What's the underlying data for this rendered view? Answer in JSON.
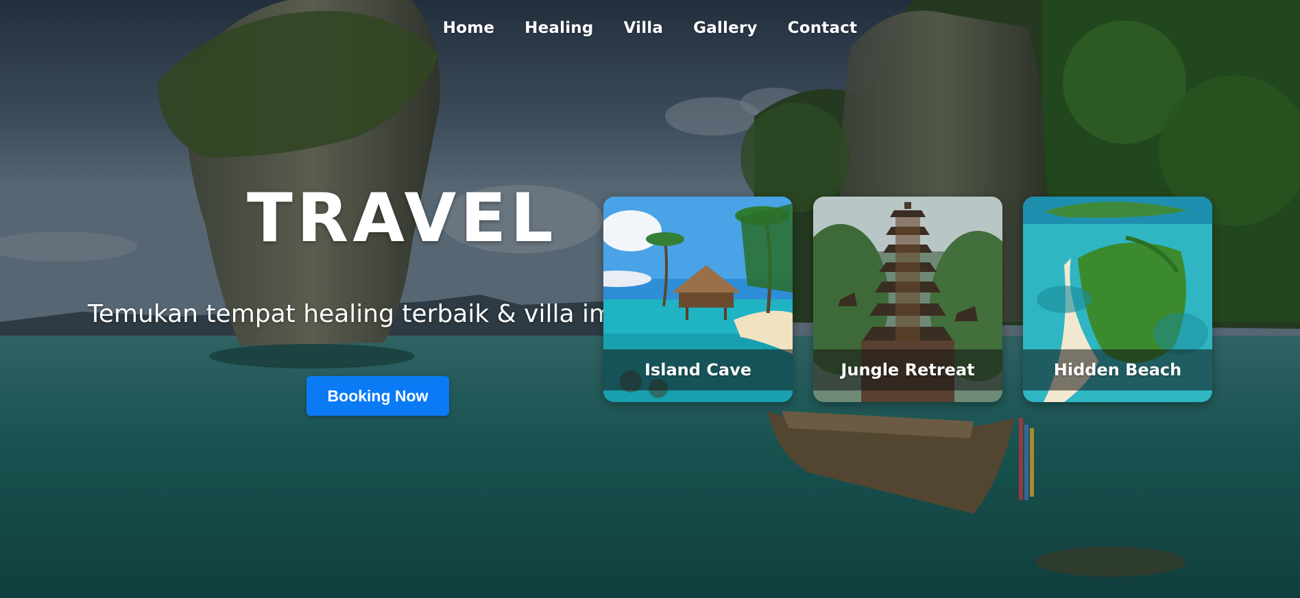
{
  "nav": {
    "items": [
      {
        "label": "Home"
      },
      {
        "label": "Healing"
      },
      {
        "label": "Villa"
      },
      {
        "label": "Gallery"
      },
      {
        "label": "Contact"
      }
    ]
  },
  "hero": {
    "title": "TRAVEL",
    "subtitle": "Temukan tempat healing terbaik & villa impian",
    "cta_label": "Booking Now"
  },
  "cards": [
    {
      "title": "Island Cave"
    },
    {
      "title": "Jungle Retreat"
    },
    {
      "title": "Hidden Beach"
    }
  ],
  "colors": {
    "accent": "#0a7bf5",
    "card_label_bg": "rgba(20,20,20,0.55)"
  }
}
